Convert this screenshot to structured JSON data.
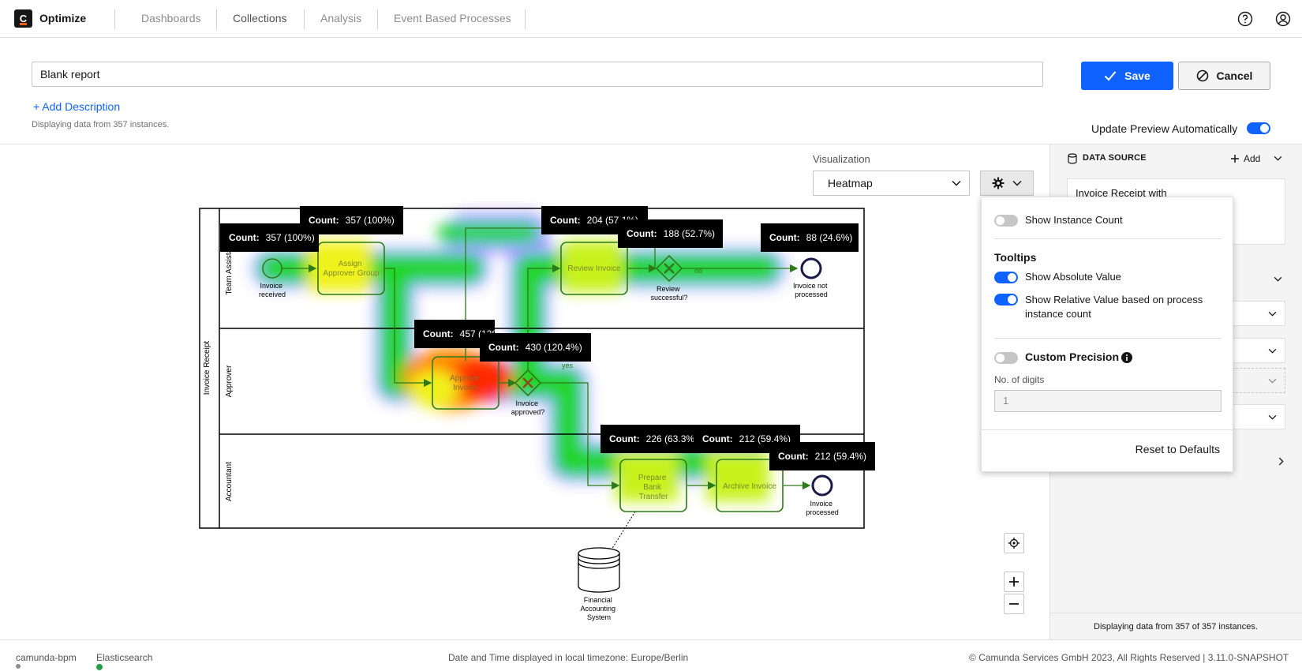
{
  "header": {
    "logo_letter": "C",
    "brand": "Optimize",
    "nav": [
      "Dashboards",
      "Collections",
      "Analysis",
      "Event Based Processes"
    ]
  },
  "report": {
    "title": "Blank report",
    "save_label": "Save",
    "cancel_label": "Cancel",
    "add_description": "+ Add Description",
    "instances_text": "Displaying data from 357 instances.",
    "auto_update_label": "Update Preview Automatically"
  },
  "visualization": {
    "label": "Visualization",
    "selected": "Heatmap"
  },
  "diagram": {
    "pool": "Invoice Receipt",
    "lanes": [
      "Team Assistant",
      "Approver",
      "Accountant"
    ],
    "nodes": {
      "invoice_received": [
        "Invoice",
        "received"
      ],
      "assign_group": [
        "Assign",
        "Approver Group"
      ],
      "review_invoice": "Review Invoice",
      "review_successful": [
        "Review",
        "successful?"
      ],
      "invoice_not_processed": [
        "Invoice not",
        "processed"
      ],
      "approve_invoice": [
        "Approve",
        "Invoice"
      ],
      "invoice_approved": [
        "Invoice",
        "approved?"
      ],
      "prepare_transfer": [
        "Prepare",
        "Bank",
        "Transfer"
      ],
      "archive_invoice": "Archive Invoice",
      "invoice_processed": [
        "Invoice",
        "processed"
      ],
      "financial_system": [
        "Financial",
        "Accounting",
        "System"
      ],
      "flow_no": "no",
      "flow_yes": "yes"
    },
    "tooltips": [
      {
        "label": "Count:",
        "value": "357 (100%)"
      },
      {
        "label": "Count:",
        "value": "357 (100%)"
      },
      {
        "label": "Count:",
        "value": "204 (57.1%)"
      },
      {
        "label": "Count:",
        "value": "188 (52.7%)"
      },
      {
        "label": "Count:",
        "value": "88 (24.6%)"
      },
      {
        "label": "Count:",
        "value": "457 (128%)"
      },
      {
        "label": "Count:",
        "value": "430 (120.4%)"
      },
      {
        "label": "Count:",
        "value": "226 (63.3%)"
      },
      {
        "label": "Count:",
        "value": "212 (59.4%)"
      },
      {
        "label": "Count:",
        "value": "212 (59.4%)"
      }
    ]
  },
  "popover": {
    "show_instance_count": "Show Instance Count",
    "tooltips_heading": "Tooltips",
    "show_absolute": "Show Absolute Value",
    "show_relative": [
      "Show Relative Value based on process",
      "instance count"
    ],
    "custom_precision": "Custom Precision",
    "digits_label": "No. of digits",
    "digits_value": "1",
    "reset": "Reset to Defaults"
  },
  "right_panel": {
    "data_source": "DATA SOURCE",
    "add": "Add",
    "source_name": "Invoice Receipt with",
    "footer": "Displaying data from 357 of 357 instances."
  },
  "footer": {
    "engine": "camunda-bpm",
    "database": "Elasticsearch",
    "timezone": "Date and Time displayed in local timezone: Europe/Berlin",
    "copyright": "© Camunda Services GmbH 2023, All Rights Reserved | 3.11.0-SNAPSHOT"
  },
  "colors": {
    "primary": "#0f62fe",
    "status_ok": "#24a148"
  }
}
